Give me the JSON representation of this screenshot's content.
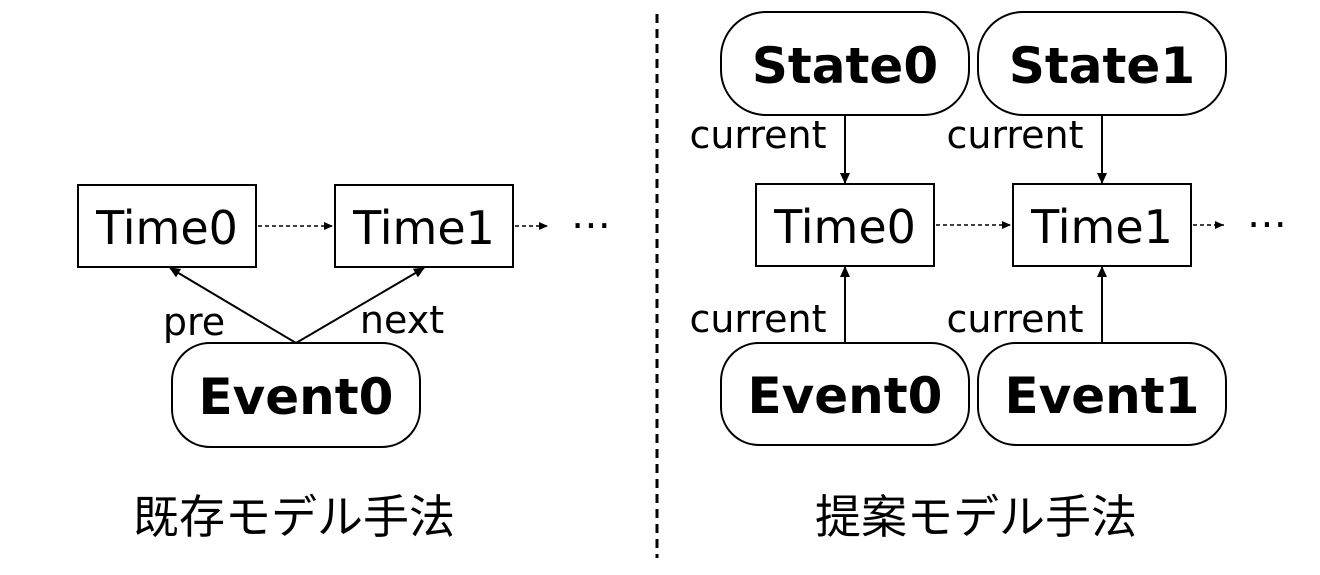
{
  "left_panel": {
    "caption": "既存モデル手法",
    "time_nodes": [
      "Time0",
      "Time1"
    ],
    "continuation": "⋯",
    "event_node": "Event0",
    "edge_labels": {
      "pre": "pre",
      "next": "next"
    }
  },
  "right_panel": {
    "caption": "提案モデル手法",
    "state_nodes": [
      "State0",
      "State1"
    ],
    "time_nodes": [
      "Time0",
      "Time1"
    ],
    "continuation": "⋯",
    "event_nodes": [
      "Event0",
      "Event1"
    ],
    "edge_labels": {
      "state0_current": "current",
      "state1_current": "current",
      "event0_current": "current",
      "event1_current": "current"
    }
  }
}
